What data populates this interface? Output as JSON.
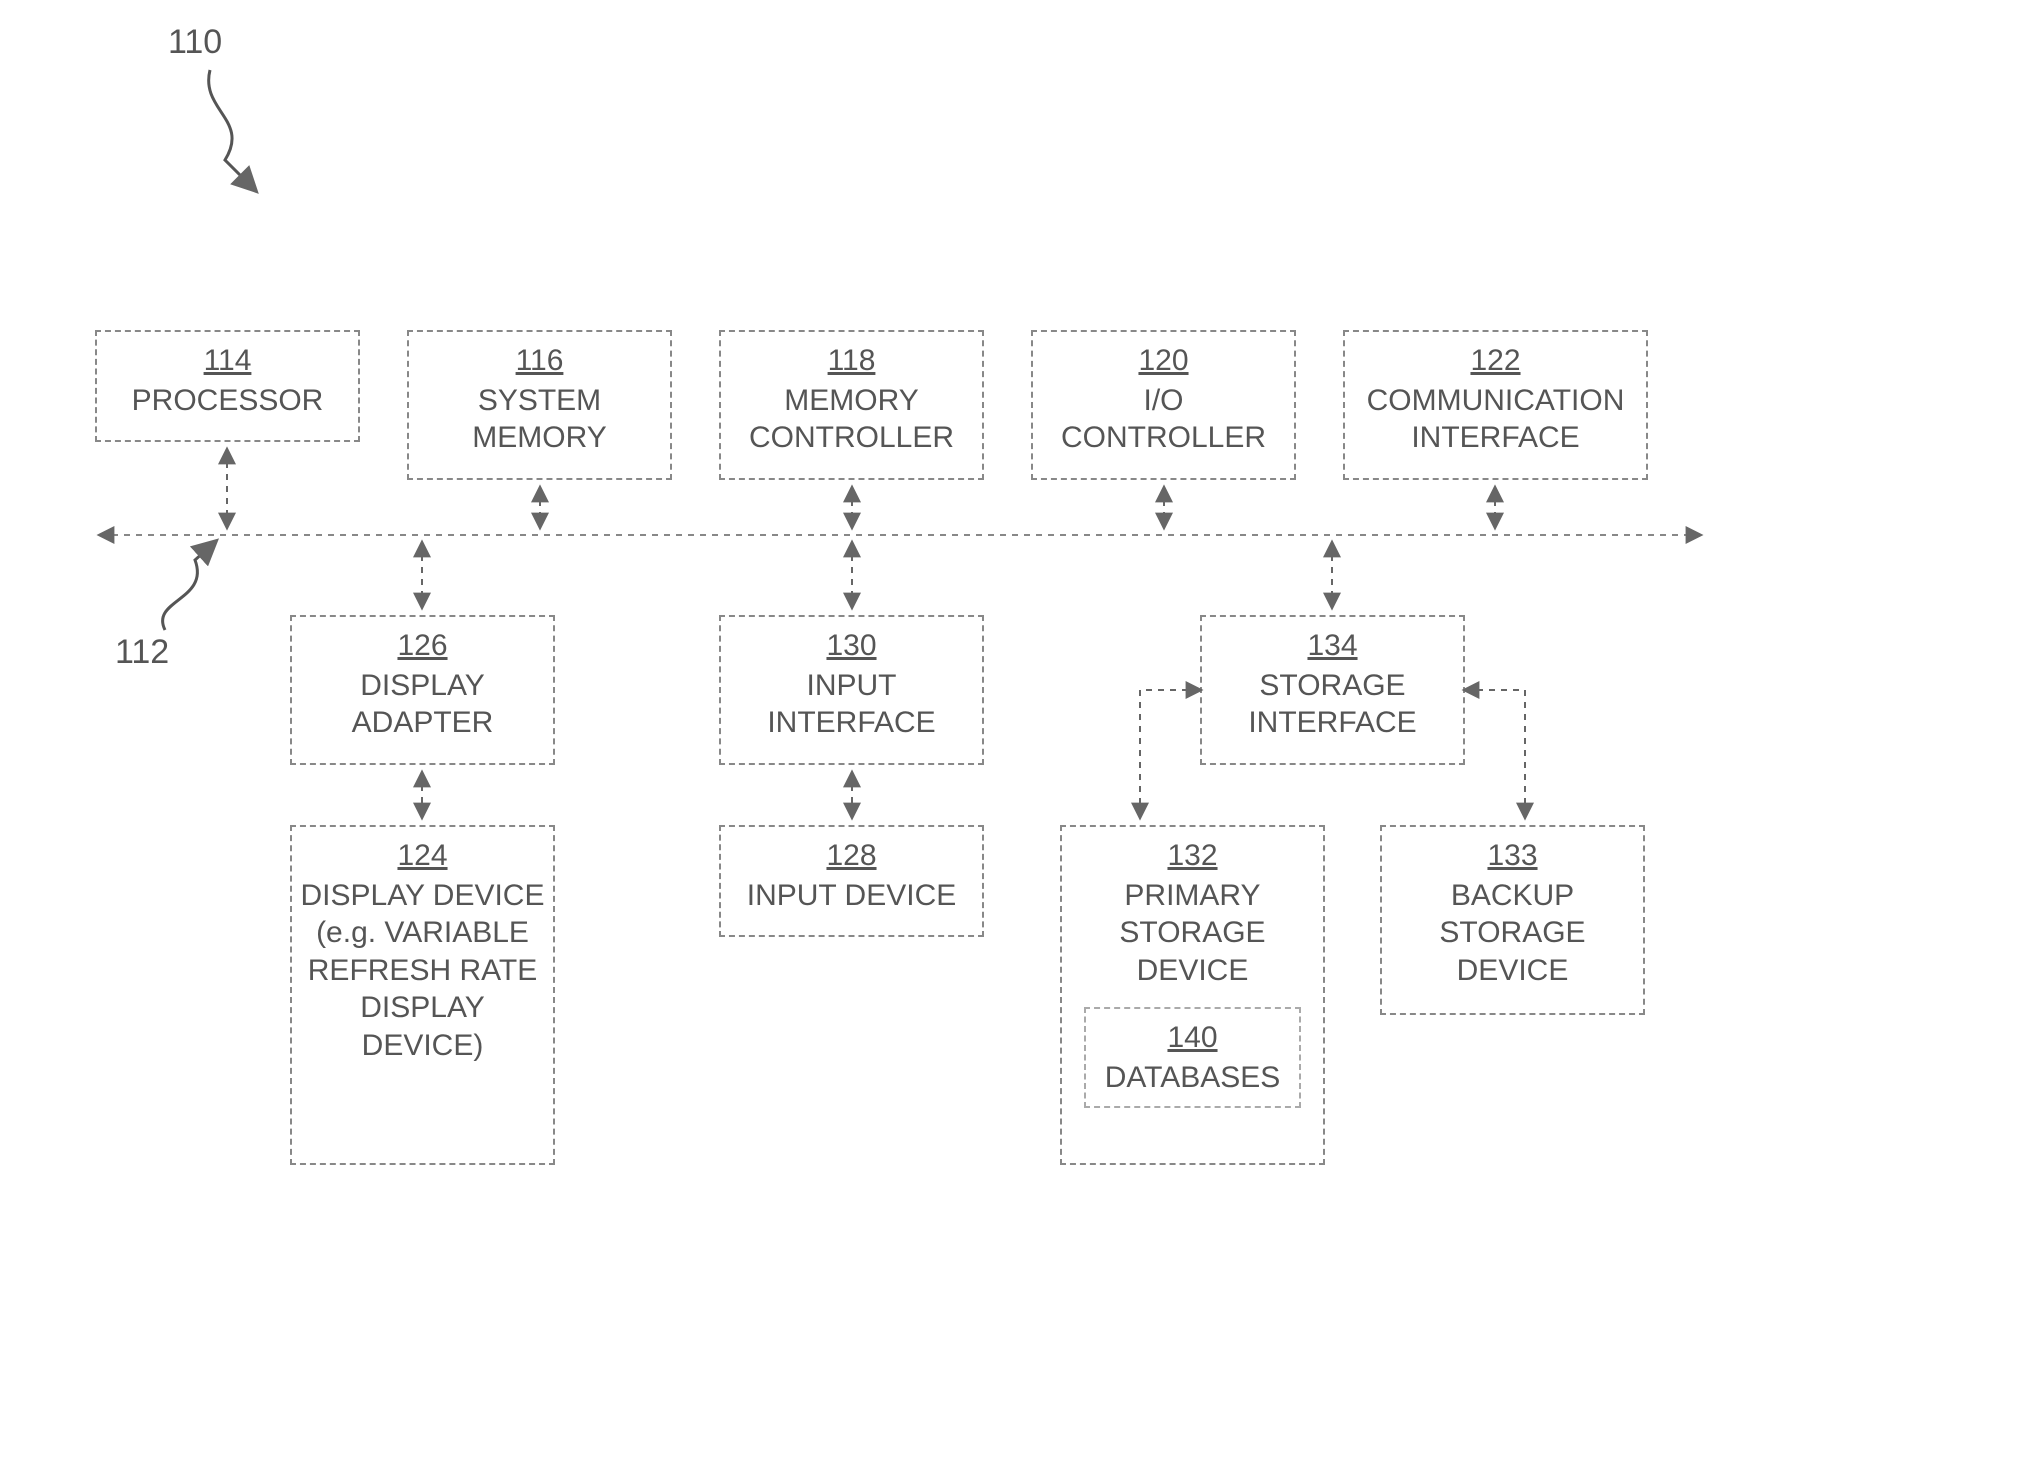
{
  "diagramNumber": "110",
  "busNumber": "112",
  "boxes": {
    "processor": {
      "num": "114",
      "label": "PROCESSOR"
    },
    "systemMemory": {
      "num": "116",
      "label": "SYSTEM MEMORY"
    },
    "memoryController": {
      "num": "118",
      "label": "MEMORY CONTROLLER"
    },
    "ioController": {
      "num": "120",
      "label": "I/O CONTROLLER"
    },
    "commInterface": {
      "num": "122",
      "label": "COMMUNICATION INTERFACE"
    },
    "displayAdapter": {
      "num": "126",
      "label": "DISPLAY ADAPTER"
    },
    "inputInterface": {
      "num": "130",
      "label": "INPUT INTERFACE"
    },
    "storageInterface": {
      "num": "134",
      "label": "STORAGE INTERFACE"
    },
    "displayDevice": {
      "num": "124",
      "label": "DISPLAY DEVICE (e.g. VARIABLE REFRESH RATE DISPLAY DEVICE)"
    },
    "inputDevice": {
      "num": "128",
      "label": "INPUT DEVICE"
    },
    "primaryStorage": {
      "num": "132",
      "label": "PRIMARY STORAGE DEVICE"
    },
    "backupStorage": {
      "num": "133",
      "label": "BACKUP STORAGE DEVICE"
    },
    "databases": {
      "num": "140",
      "label": "DATABASES"
    }
  }
}
